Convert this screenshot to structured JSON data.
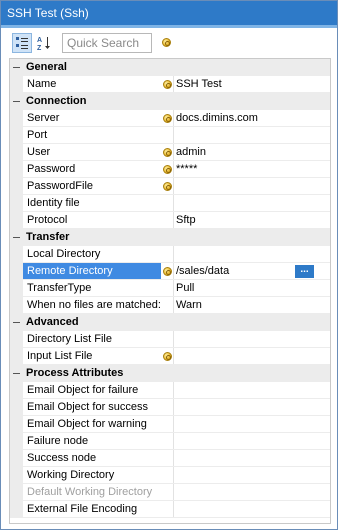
{
  "window": {
    "title": "SSH Test (Ssh)"
  },
  "toolbar": {
    "search_placeholder": "Quick Search",
    "categorized_icon": "categorized-icon",
    "alphabetical_icon": "alphabetical-sort-icon",
    "help_icon": "coin-icon"
  },
  "categories": [
    {
      "label": "General",
      "properties": [
        {
          "name": "Name",
          "icon": true,
          "value": "SSH Test"
        }
      ]
    },
    {
      "label": "Connection",
      "properties": [
        {
          "name": "Server",
          "icon": true,
          "value": "docs.dimins.com"
        },
        {
          "name": "Port",
          "icon": false,
          "value": ""
        },
        {
          "name": "User",
          "icon": true,
          "value": "admin"
        },
        {
          "name": "Password",
          "icon": true,
          "value": "*****"
        },
        {
          "name": "PasswordFile",
          "icon": true,
          "value": ""
        },
        {
          "name": "Identity file",
          "icon": false,
          "value": ""
        },
        {
          "name": "Protocol",
          "icon": false,
          "value": "Sftp"
        }
      ]
    },
    {
      "label": "Transfer",
      "properties": [
        {
          "name": "Local Directory",
          "icon": false,
          "value": ""
        },
        {
          "name": "Remote Directory",
          "icon": true,
          "value": "/sales/data",
          "selected": true,
          "ellipsis": "..."
        },
        {
          "name": "TransferType",
          "icon": false,
          "value": "Pull"
        },
        {
          "name": "When no files are matched:",
          "icon": false,
          "value": "Warn"
        }
      ]
    },
    {
      "label": "Advanced",
      "properties": [
        {
          "name": "Directory List File",
          "icon": false,
          "value": ""
        },
        {
          "name": "Input List File",
          "icon": true,
          "value": ""
        }
      ]
    },
    {
      "label": "Process Attributes",
      "properties": [
        {
          "name": "Email Object for failure",
          "icon": false,
          "value": ""
        },
        {
          "name": "Email Object for success",
          "icon": false,
          "value": ""
        },
        {
          "name": "Email Object for warning",
          "icon": false,
          "value": ""
        },
        {
          "name": "Failure node",
          "icon": false,
          "value": ""
        },
        {
          "name": "Success node",
          "icon": false,
          "value": ""
        },
        {
          "name": "Working Directory",
          "icon": false,
          "value": ""
        },
        {
          "name": "Default Working Directory",
          "icon": false,
          "value": "",
          "disabled": true
        },
        {
          "name": "External File Encoding",
          "icon": false,
          "value": ""
        }
      ]
    }
  ]
}
